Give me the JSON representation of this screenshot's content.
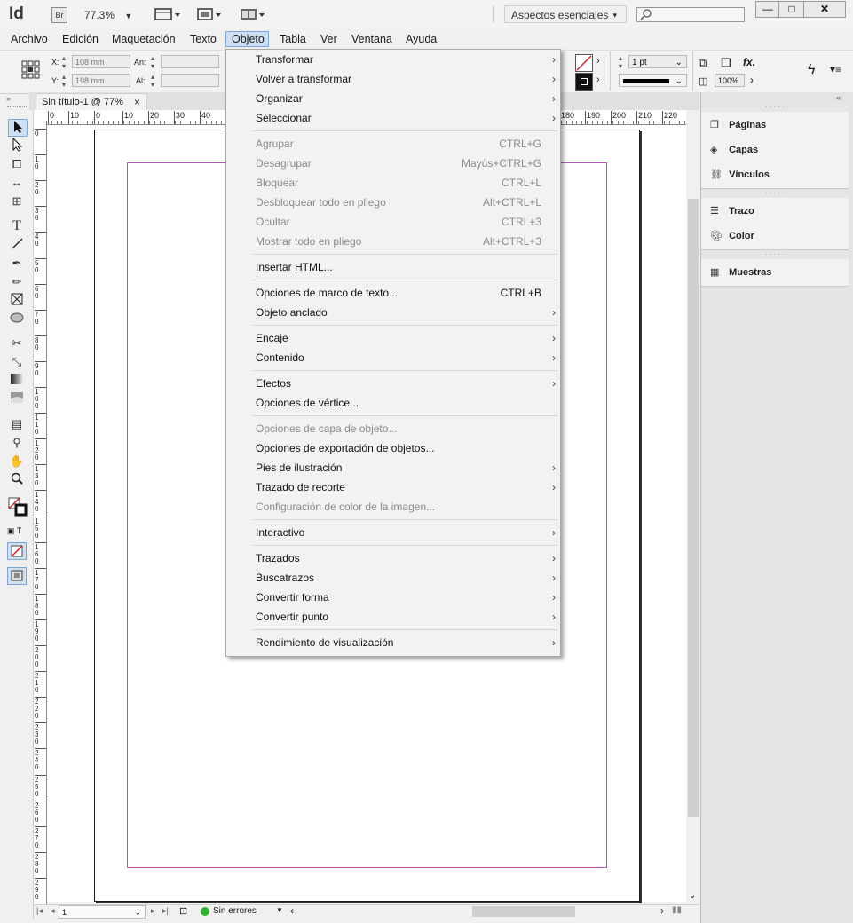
{
  "app": {
    "logo": "Id",
    "bridge_label": "Br",
    "zoom": "77.3%",
    "workspace": "Aspectos esenciales",
    "window_controls": [
      "minimize-icon",
      "maximize-icon",
      "close-icon"
    ]
  },
  "menubar": [
    "Archivo",
    "Edición",
    "Maquetación",
    "Texto",
    "Objeto",
    "Tabla",
    "Ver",
    "Ventana",
    "Ayuda"
  ],
  "control": {
    "x_label": "X:",
    "x_value": "108 mm",
    "y_label": "Y:",
    "y_value": "198 mm",
    "w_label": "An:",
    "h_label": "Al:",
    "stroke_weight": "1 pt",
    "opacity": "100%",
    "fx": "fx."
  },
  "document": {
    "tab_title": "Sin título-1 @ 77%",
    "tab_close": "×"
  },
  "ruler": {
    "h_ticks": [
      "0",
      "10",
      "0",
      "10",
      "20",
      "30",
      "40",
      "180",
      "190",
      "200",
      "210",
      "220"
    ],
    "v_ticks": [
      "0",
      "1\n0",
      "2\n0",
      "3\n0",
      "4\n0",
      "5\n0",
      "6\n0",
      "7\n0",
      "8\n0",
      "9\n0",
      "1\n0\n0",
      "1\n1\n0",
      "1\n2\n0",
      "1\n3\n0",
      "1\n4\n0",
      "1\n5\n0",
      "1\n6\n0",
      "1\n7\n0",
      "1\n8\n0",
      "1\n9\n0",
      "2\n0\n0",
      "2\n1\n0",
      "2\n2\n0",
      "2\n3\n0",
      "2\n4\n0",
      "2\n5\n0",
      "2\n6\n0",
      "2\n7\n0",
      "2\n8\n0",
      "2\n9\n0"
    ]
  },
  "status": {
    "page_number": "1",
    "preflight": "Sin errores"
  },
  "panels": {
    "group1": [
      "Páginas",
      "Capas",
      "Vínculos"
    ],
    "group2": [
      "Trazo",
      "Color"
    ],
    "group3": [
      "Muestras"
    ]
  },
  "dropdown": {
    "items": [
      {
        "label": "Transformar",
        "shortcut": "",
        "submenu": true,
        "disabled": false
      },
      {
        "label": "Volver a transformar",
        "shortcut": "",
        "submenu": true,
        "disabled": false
      },
      {
        "label": "Organizar",
        "shortcut": "",
        "submenu": true,
        "disabled": false
      },
      {
        "label": "Seleccionar",
        "shortcut": "",
        "submenu": true,
        "disabled": false
      },
      {
        "sep": true
      },
      {
        "label": "Agrupar",
        "shortcut": "CTRL+G",
        "submenu": false,
        "disabled": true
      },
      {
        "label": "Desagrupar",
        "shortcut": "Mayús+CTRL+G",
        "submenu": false,
        "disabled": true
      },
      {
        "label": "Bloquear",
        "shortcut": "CTRL+L",
        "submenu": false,
        "disabled": true
      },
      {
        "label": "Desbloquear todo en pliego",
        "shortcut": "Alt+CTRL+L",
        "submenu": false,
        "disabled": true
      },
      {
        "label": "Ocultar",
        "shortcut": "CTRL+3",
        "submenu": false,
        "disabled": true
      },
      {
        "label": "Mostrar todo en pliego",
        "shortcut": "Alt+CTRL+3",
        "submenu": false,
        "disabled": true
      },
      {
        "sep": true
      },
      {
        "label": "Insertar HTML...",
        "shortcut": "",
        "submenu": false,
        "disabled": false
      },
      {
        "sep": true
      },
      {
        "label": "Opciones de marco de texto...",
        "shortcut": "CTRL+B",
        "submenu": false,
        "disabled": false
      },
      {
        "label": "Objeto anclado",
        "shortcut": "",
        "submenu": true,
        "disabled": false
      },
      {
        "sep": true
      },
      {
        "label": "Encaje",
        "shortcut": "",
        "submenu": true,
        "disabled": false
      },
      {
        "label": "Contenido",
        "shortcut": "",
        "submenu": true,
        "disabled": false
      },
      {
        "sep": true
      },
      {
        "label": "Efectos",
        "shortcut": "",
        "submenu": true,
        "disabled": false
      },
      {
        "label": "Opciones de vértice...",
        "shortcut": "",
        "submenu": false,
        "disabled": false
      },
      {
        "sep": true
      },
      {
        "label": "Opciones de capa de objeto...",
        "shortcut": "",
        "submenu": false,
        "disabled": true
      },
      {
        "label": "Opciones de exportación de objetos...",
        "shortcut": "",
        "submenu": false,
        "disabled": false
      },
      {
        "label": "Pies de ilustración",
        "shortcut": "",
        "submenu": true,
        "disabled": false
      },
      {
        "label": "Trazado de recorte",
        "shortcut": "",
        "submenu": true,
        "disabled": false
      },
      {
        "label": "Configuración de color de la imagen...",
        "shortcut": "",
        "submenu": false,
        "disabled": true
      },
      {
        "sep": true
      },
      {
        "label": "Interactivo",
        "shortcut": "",
        "submenu": true,
        "disabled": false
      },
      {
        "sep": true
      },
      {
        "label": "Trazados",
        "shortcut": "",
        "submenu": true,
        "disabled": false
      },
      {
        "label": "Buscatrazos",
        "shortcut": "",
        "submenu": true,
        "disabled": false
      },
      {
        "label": "Convertir forma",
        "shortcut": "",
        "submenu": true,
        "disabled": false
      },
      {
        "label": "Convertir punto",
        "shortcut": "",
        "submenu": true,
        "disabled": false
      },
      {
        "sep": true
      },
      {
        "label": "Rendimiento de visualización",
        "shortcut": "",
        "submenu": true,
        "disabled": false
      }
    ]
  },
  "colors": {
    "margin_guide": "#c04ac0",
    "menu_highlight": "#cfe0f3",
    "preflight_ok": "#2db32d"
  }
}
